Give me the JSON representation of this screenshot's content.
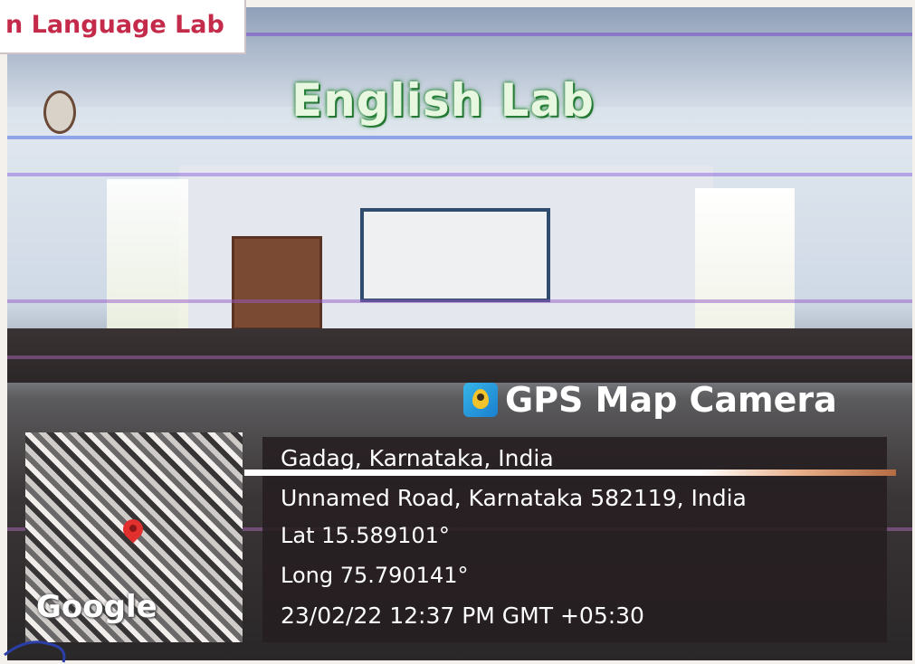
{
  "badge": {
    "label": "n Language Lab"
  },
  "scene": {
    "title": "English  Lab"
  },
  "gps_overlay": {
    "brand": "GPS Map Camera",
    "place": "Gadag, Karnataka, India",
    "address": "Unnamed Road, Karnataka 582119, India",
    "latitude": "Lat 15.589101°",
    "longitude": "Long 75.790141°",
    "timestamp": "23/02/22 12:37 PM GMT +05:30",
    "map_attribution": "Google",
    "pin_icon": "map-pin-icon",
    "accent_color": "#e2302f"
  }
}
